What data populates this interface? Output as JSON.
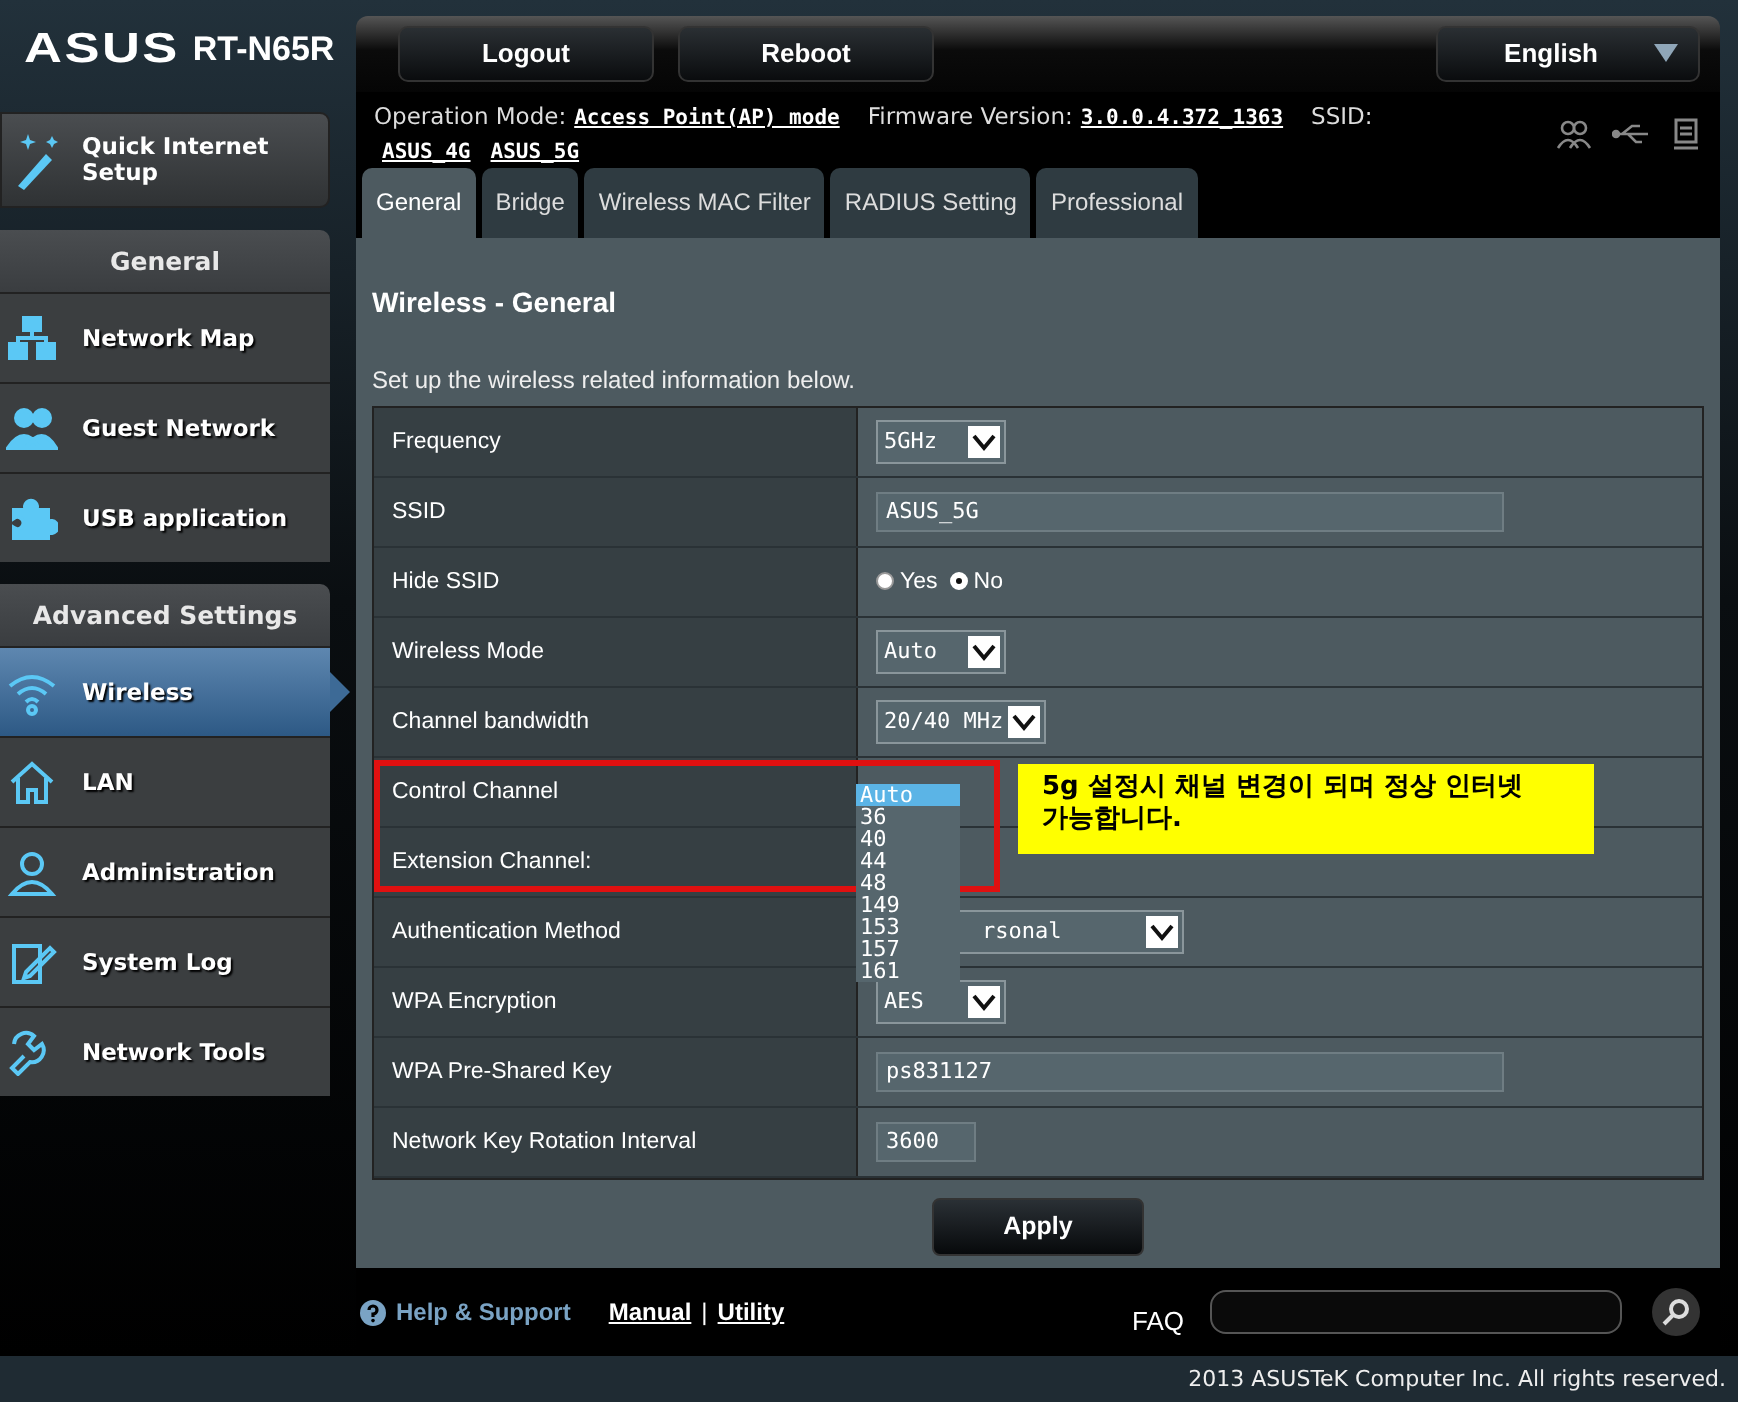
{
  "brand": {
    "logo": "ASUS",
    "model": "RT-N65R"
  },
  "header_buttons": [
    "Logout",
    "Reboot"
  ],
  "language": "English",
  "info": {
    "operation_mode_label": "Operation Mode:",
    "operation_mode": "Access Point(AP) mode",
    "firmware_label": "Firmware Version:",
    "firmware": "3.0.0.4.372_1363",
    "ssid_label": "SSID:",
    "ssids": [
      "ASUS_4G",
      "ASUS_5G"
    ]
  },
  "sidebar": {
    "quick_setup": "Quick Internet Setup",
    "sections": [
      {
        "title": "General",
        "items": [
          {
            "label": "Network Map",
            "selected": false
          },
          {
            "label": "Guest Network",
            "selected": false
          },
          {
            "label": "USB application",
            "selected": false
          }
        ]
      },
      {
        "title": "Advanced Settings",
        "items": [
          {
            "label": "Wireless",
            "selected": true
          },
          {
            "label": "LAN",
            "selected": false
          },
          {
            "label": "Administration",
            "selected": false
          },
          {
            "label": "System Log",
            "selected": false
          },
          {
            "label": "Network Tools",
            "selected": false
          }
        ]
      }
    ]
  },
  "tabs": [
    {
      "label": "General",
      "selected": true
    },
    {
      "label": "Bridge",
      "selected": false
    },
    {
      "label": "Wireless MAC Filter",
      "selected": false
    },
    {
      "label": "RADIUS Setting",
      "selected": false
    },
    {
      "label": "Professional",
      "selected": false
    }
  ],
  "panel": {
    "title": "Wireless - General",
    "description": "Set up the wireless related information below.",
    "rows": [
      {
        "label": "Frequency",
        "kind": "select",
        "value": "5GHz"
      },
      {
        "label": "SSID",
        "kind": "text",
        "value": "ASUS_5G"
      },
      {
        "label": "Hide SSID",
        "kind": "radio",
        "options": [
          {
            "label": "Yes",
            "selected": false
          },
          {
            "label": "No",
            "selected": true
          }
        ]
      },
      {
        "label": "Wireless Mode",
        "kind": "select",
        "value": "Auto"
      },
      {
        "label": "Channel bandwidth",
        "kind": "select",
        "value": "20/40 MHz"
      },
      {
        "label": "Control Channel",
        "kind": "open_select",
        "options": [
          {
            "label": "Auto",
            "selected": true
          },
          {
            "label": "36",
            "selected": false
          },
          {
            "label": "40",
            "selected": false
          },
          {
            "label": "44",
            "selected": false
          },
          {
            "label": "48",
            "selected": false
          },
          {
            "label": "149",
            "selected": false
          },
          {
            "label": "153",
            "selected": false
          },
          {
            "label": "157",
            "selected": false
          },
          {
            "label": "161",
            "selected": false
          }
        ]
      },
      {
        "label": "Extension Channel:",
        "kind": "none"
      },
      {
        "label": "Authentication Method",
        "kind": "covered_select",
        "value": "rsonal"
      },
      {
        "label": "WPA Encryption",
        "kind": "select",
        "value": "AES"
      },
      {
        "label": "WPA Pre-Shared Key",
        "kind": "text",
        "value": "ps831127"
      },
      {
        "label": "Network Key Rotation Interval",
        "kind": "short_text",
        "value": "3600"
      }
    ]
  },
  "annotation": {
    "note": "5g 설정시 채널 변경이 되며 정상 인터넷 가능합니다."
  },
  "apply": "Apply",
  "footer": {
    "help": "Help & Support",
    "links": [
      "Manual",
      "Utility"
    ],
    "separator": "|",
    "faq": "FAQ"
  },
  "copyright": "2013 ASUSTeK Computer Inc. All rights reserved."
}
